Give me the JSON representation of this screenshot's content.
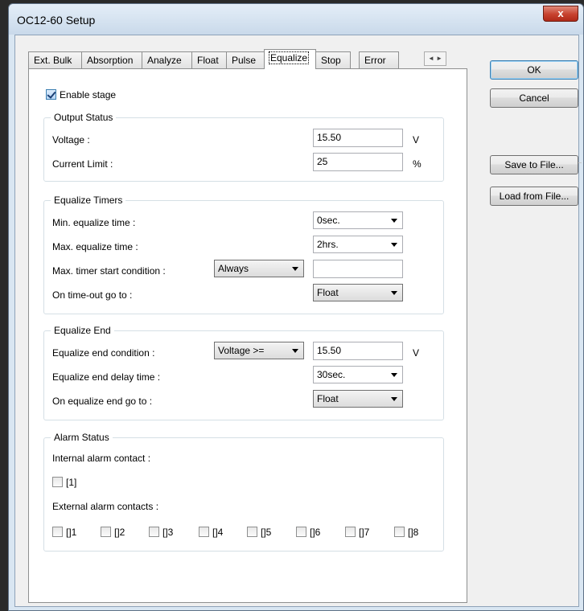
{
  "window": {
    "title": "OC12-60 Setup",
    "close_label": "x"
  },
  "tabs": [
    "Ext. Bulk",
    "Absorption",
    "Analyze",
    "Float",
    "Pulse",
    "Equalize",
    "Stop",
    "Error"
  ],
  "active_tab": "Equalize",
  "tab_scroll": {
    "left": "◄",
    "right": "►"
  },
  "enable_stage": {
    "label": "Enable stage",
    "checked": true
  },
  "output_status": {
    "title": "Output Status",
    "voltage_label": "Voltage :",
    "voltage_value": "15.50",
    "voltage_unit": "V",
    "current_label": "Current Limit :",
    "current_value": "25",
    "current_unit": "%"
  },
  "timers": {
    "title": "Equalize Timers",
    "min_label": "Min. equalize time :",
    "min_value": "0sec.",
    "max_label": "Max. equalize time :",
    "max_value": "2hrs.",
    "start_label": "Max. timer start condition :",
    "start_value": "Always",
    "start_extra": "",
    "timeout_label": "On time-out go to :",
    "timeout_value": "Float"
  },
  "end": {
    "title": "Equalize End",
    "cond_label": "Equalize end condition :",
    "cond_value": "Voltage >=",
    "cond_number": "15.50",
    "cond_unit": "V",
    "delay_label": "Equalize end delay time :",
    "delay_value": "30sec.",
    "goto_label": "On equalize end go to :",
    "goto_value": "Float"
  },
  "alarm": {
    "title": "Alarm Status",
    "internal_label": "Internal alarm contact :",
    "internal_contact": "[1]",
    "external_label": "External alarm contacts :",
    "external_contacts": [
      "[]1",
      "[]2",
      "[]3",
      "[]4",
      "[]5",
      "[]6",
      "[]7",
      "[]8"
    ]
  },
  "buttons": {
    "ok": "OK",
    "cancel": "Cancel",
    "save": "Save to File...",
    "load": "Load from File..."
  }
}
